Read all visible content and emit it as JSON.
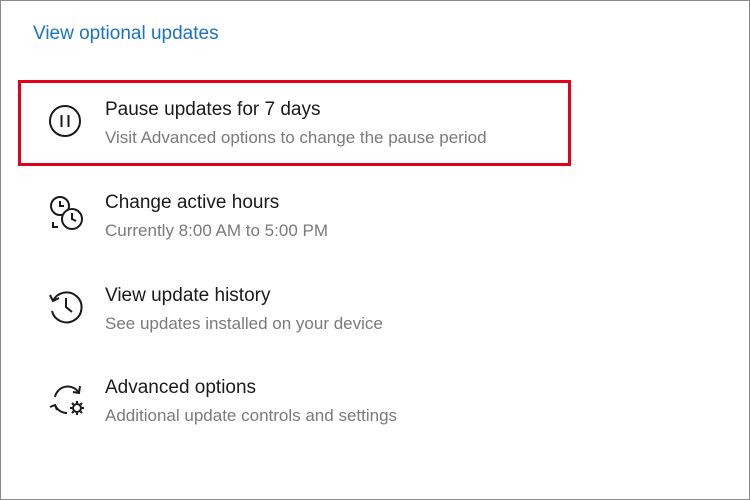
{
  "optional_link": "View optional updates",
  "items": [
    {
      "title": "Pause updates for 7 days",
      "subtitle": "Visit Advanced options to change the pause period",
      "icon": "pause-icon"
    },
    {
      "title": "Change active hours",
      "subtitle": "Currently 8:00 AM to 5:00 PM",
      "icon": "active-hours-icon"
    },
    {
      "title": "View update history",
      "subtitle": "See updates installed on your device",
      "icon": "history-icon"
    },
    {
      "title": "Advanced options",
      "subtitle": "Additional update controls and settings",
      "icon": "advanced-options-icon"
    }
  ],
  "colors": {
    "link": "#1a73c8",
    "highlight_border": "#e3001b",
    "title_text": "#1a1a1a",
    "subtitle_text": "#7a7a7a"
  }
}
